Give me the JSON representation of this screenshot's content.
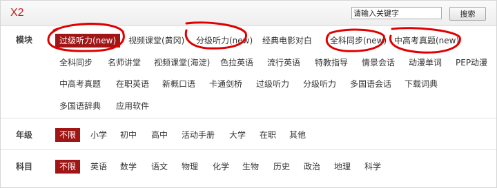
{
  "app": {
    "title": "X2"
  },
  "search": {
    "placeholder": "请输入关键字",
    "value": "请输入关键字",
    "button_label": "搜索"
  },
  "module": {
    "label": "模块",
    "items": [
      "过级听力(new)",
      "视频课堂(黄冈)",
      "分级听力(new)",
      "经典电影对白",
      "全科同步(new)",
      "中高考真题(new)",
      "全科同步",
      "名师讲堂",
      "视频课堂(海淀)",
      "色拉英语",
      "流行英语",
      "特教指导",
      "情景会话",
      "动漫单词",
      "PEP动漫",
      "中高考真题",
      "在职英语",
      "新概口语",
      "卡通剑桥",
      "过级听力",
      "分级听力",
      "多国语会话",
      "下载词典",
      "多国语辞典",
      "应用软件"
    ]
  },
  "grade": {
    "label": "年级",
    "items": [
      "不限",
      "小学",
      "初中",
      "高中",
      "活动手册",
      "大学",
      "在职",
      "其他"
    ]
  },
  "subject": {
    "label": "科目",
    "items": [
      "不限",
      "英语",
      "数学",
      "语文",
      "物理",
      "化学",
      "生物",
      "历史",
      "政治",
      "地理",
      "科学"
    ]
  },
  "colors": {
    "accent": "#a01616",
    "annotation": "#e00000"
  }
}
